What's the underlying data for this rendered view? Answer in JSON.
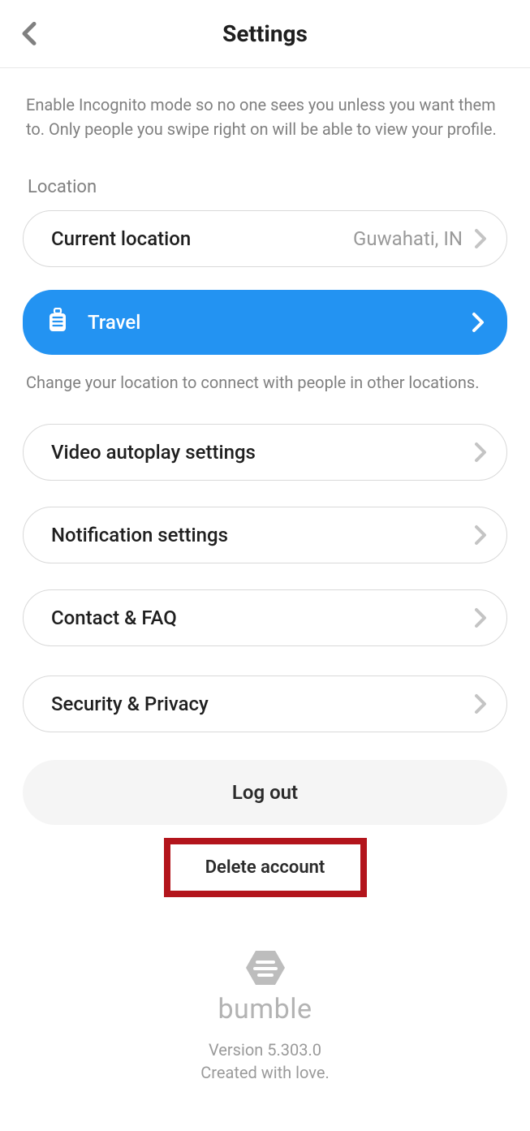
{
  "header": {
    "title": "Settings"
  },
  "incognito_description": "Enable Incognito mode so no one sees you unless you want them to. Only people you swipe right on will be able to view your profile.",
  "location": {
    "section_label": "Location",
    "current_location_label": "Current location",
    "current_location_value": "Guwahati, IN"
  },
  "travel": {
    "label": "Travel",
    "description": "Change your location to connect with people in other locations."
  },
  "rows": {
    "video_autoplay": "Video autoplay settings",
    "notification_settings": "Notification settings",
    "contact_faq": "Contact & FAQ",
    "security_privacy": "Security & Privacy"
  },
  "logout_label": "Log out",
  "delete_label": "Delete account",
  "footer": {
    "brand": "bumble",
    "version": "Version 5.303.0",
    "love": "Created with love."
  }
}
